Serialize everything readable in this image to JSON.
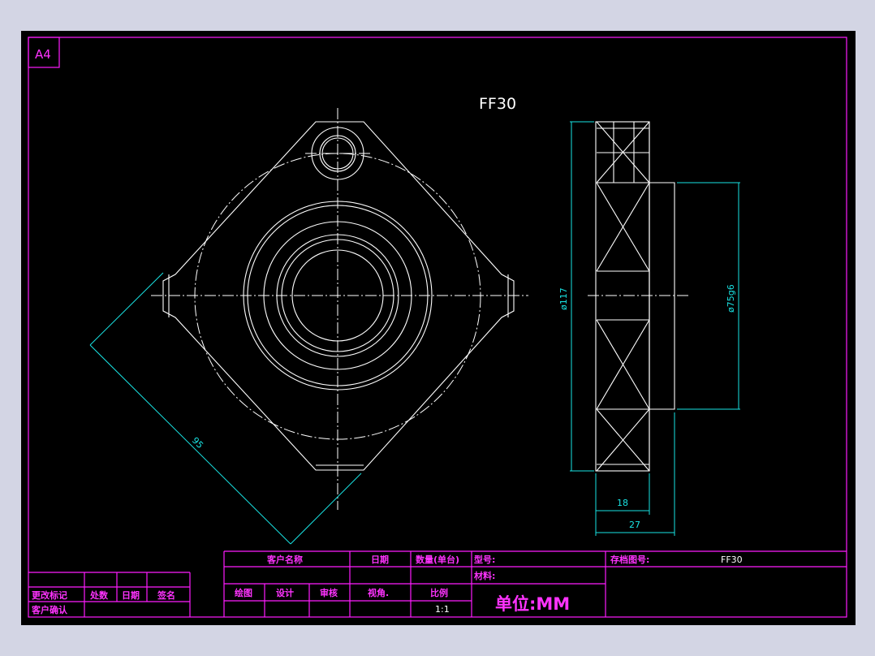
{
  "sheet": {
    "size_label": "A4"
  },
  "part": {
    "title": "FF30"
  },
  "dimensions": {
    "diagonal": "95",
    "outer_diameter": "ø117",
    "pilot_diameter": "ø75g6",
    "width_inner": "18",
    "width_total": "27"
  },
  "title_block": {
    "customer_name_label": "客户名称",
    "date_label": "日期",
    "quantity_label": "数量(单台)",
    "model_label": "型号:",
    "archive_label": "存档图号:",
    "archive_value": "FF30",
    "material_label": "材料:",
    "drawn_label": "绘图",
    "design_label": "设计",
    "review_label": "审核",
    "view_label": "视角.",
    "scale_label": "比例",
    "scale_value": "1:1",
    "unit_label": "单位:MM"
  },
  "revision_block": {
    "change_mark": "更改标记",
    "place_count": "处数",
    "date": "日期",
    "sign": "签名",
    "customer_confirm": "客户确认"
  },
  "colors": {
    "background": "#d3d5e4",
    "sheet": "#000000",
    "frame": "#ff1cff",
    "lines": "#ffffff",
    "dimensions": "#19e3e3"
  }
}
